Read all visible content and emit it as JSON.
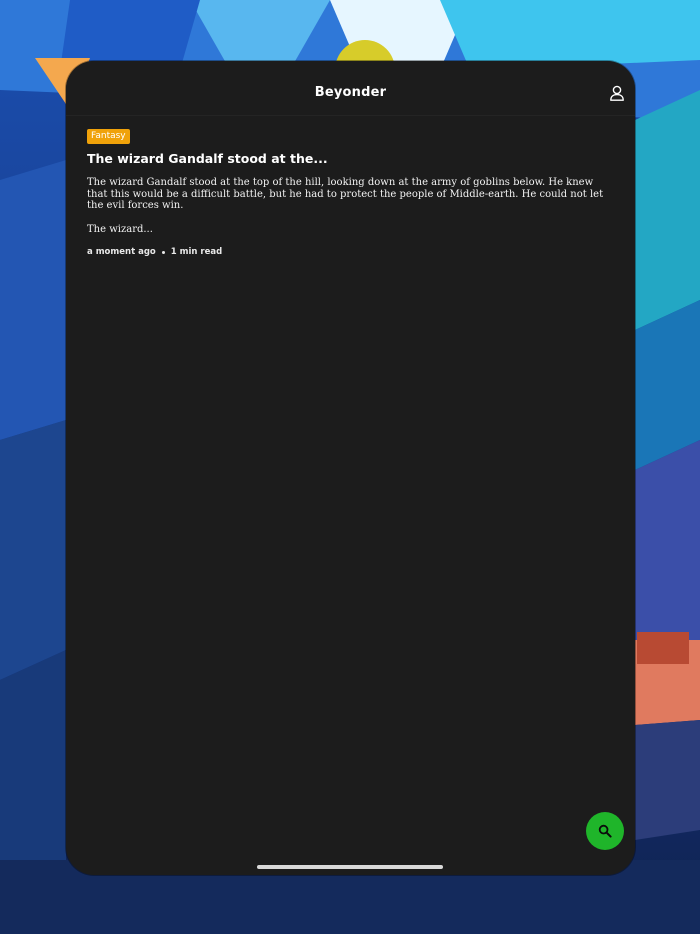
{
  "app": {
    "title": "Beyonder"
  },
  "header": {
    "profile_icon": "user-profile-icon"
  },
  "story": {
    "genre": "Fantasy",
    "title": "The wizard Gandalf stood at the...",
    "excerpt": "The wizard Gandalf stood at the top of the hill, looking down at the army of goblins below. He knew that this would be a difficult battle, but he had to protect the people of Middle-earth. He could not let the evil forces win.",
    "excerpt_continued": "The wizard...",
    "time_ago": "a moment ago",
    "read_time": "1 min read"
  },
  "fab": {
    "icon": "search-icon",
    "color": "#1fb52a"
  },
  "colors": {
    "tag": "#f0a20a",
    "background": "#1c1c1c"
  }
}
